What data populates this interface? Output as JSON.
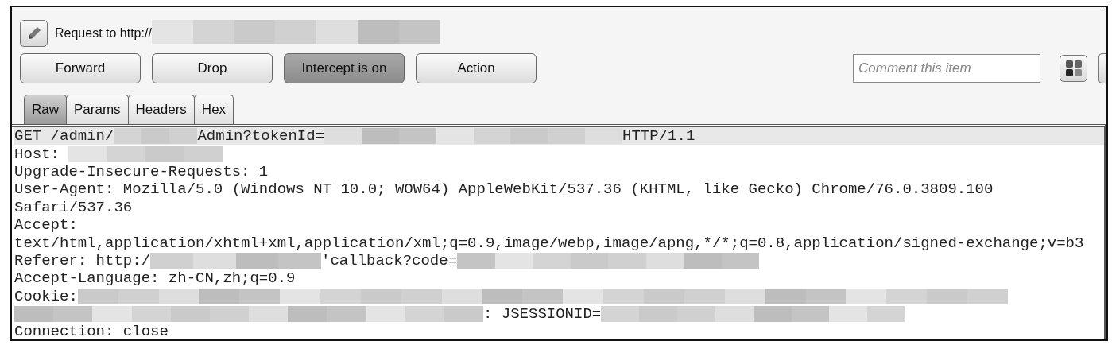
{
  "title": {
    "text": "Request to http://",
    "redacted": true
  },
  "buttons": [
    {
      "label": "Forward",
      "pressed": false
    },
    {
      "label": "Drop",
      "pressed": false
    },
    {
      "label": "Intercept is on",
      "pressed": true
    },
    {
      "label": "Action",
      "pressed": false
    }
  ],
  "comment": {
    "placeholder": "Comment this item"
  },
  "tabs": [
    {
      "label": "Raw",
      "selected": true
    },
    {
      "label": "Params",
      "selected": false
    },
    {
      "label": "Headers",
      "selected": false
    },
    {
      "label": "Hex",
      "selected": false
    }
  ],
  "lines": [
    {
      "highlighted": true,
      "segments": [
        {
          "kind": "text",
          "text": "GET /admin/"
        },
        {
          "kind": "redacted"
        },
        {
          "kind": "text",
          "text": "Admin?tokenId="
        },
        {
          "kind": "redacted"
        },
        {
          "kind": "text",
          "text": "HTTP/1.1"
        }
      ]
    },
    {
      "highlighted": false,
      "segments": [
        {
          "kind": "text",
          "text": "Host: "
        },
        {
          "kind": "redacted"
        }
      ]
    },
    {
      "highlighted": false,
      "segments": [
        {
          "kind": "text",
          "text": "Upgrade-Insecure-Requests: 1"
        }
      ]
    },
    {
      "highlighted": false,
      "segments": [
        {
          "kind": "text",
          "text": "User-Agent: Mozilla/5.0 (Windows NT 10.0; WOW64) AppleWebKit/537.36 (KHTML, like Gecko) Chrome/76.0.3809.100"
        }
      ]
    },
    {
      "highlighted": false,
      "segments": [
        {
          "kind": "text",
          "text": "Safari/537.36"
        }
      ]
    },
    {
      "highlighted": false,
      "segments": [
        {
          "kind": "text",
          "text": "Accept:"
        }
      ]
    },
    {
      "highlighted": false,
      "segments": [
        {
          "kind": "text",
          "text": "text/html,application/xhtml+xml,application/xml;q=0.9,image/webp,image/apng,*/*;q=0.8,application/signed-exchange;v=b3"
        }
      ]
    },
    {
      "highlighted": false,
      "segments": [
        {
          "kind": "text",
          "text": "Referer: http:/"
        },
        {
          "kind": "redacted"
        },
        {
          "kind": "text",
          "text": "'callback?code="
        },
        {
          "kind": "redacted"
        }
      ]
    },
    {
      "highlighted": false,
      "segments": [
        {
          "kind": "text",
          "text": "Accept-Language: zh-CN,zh;q=0.9"
        }
      ]
    },
    {
      "highlighted": false,
      "segments": [
        {
          "kind": "text",
          "text": "Cookie:"
        },
        {
          "kind": "redacted"
        }
      ]
    },
    {
      "highlighted": false,
      "segments": [
        {
          "kind": "redacted"
        },
        {
          "kind": "text",
          "text": ": JSESSIONID="
        },
        {
          "kind": "redacted"
        }
      ]
    },
    {
      "highlighted": false,
      "segments": [
        {
          "kind": "text",
          "text": "Connection: close"
        }
      ]
    }
  ]
}
